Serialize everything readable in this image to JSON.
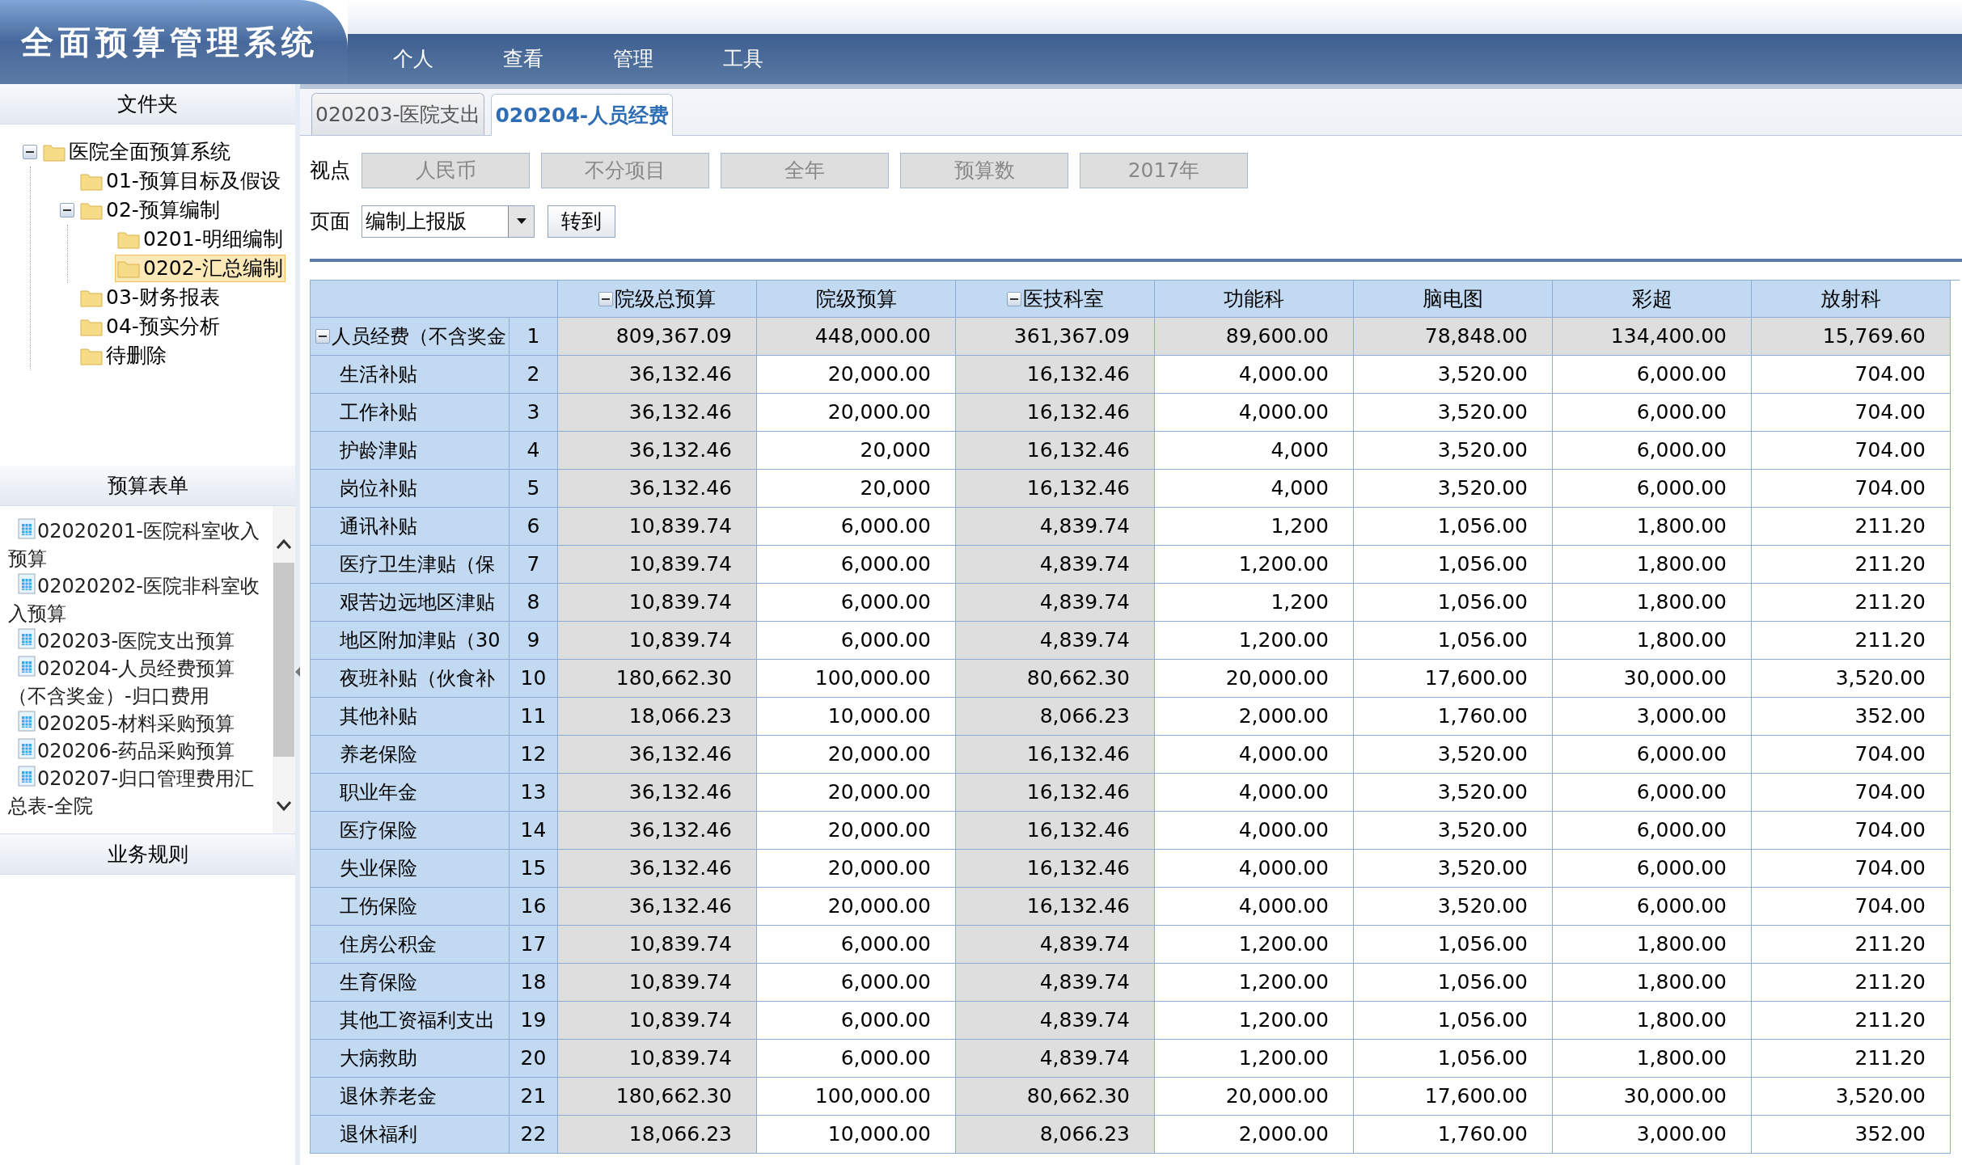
{
  "app": {
    "title": "全面预算管理系统",
    "menu": [
      "个人",
      "查看",
      "管理",
      "工具"
    ]
  },
  "sidebar": {
    "folders_panel": {
      "title": "文件夹",
      "tree": [
        {
          "label": "医院全面预算系统",
          "expanded": true,
          "selected": false,
          "children": [
            {
              "label": "01-预算目标及假设",
              "selected": false
            },
            {
              "label": "02-预算编制",
              "expanded": true,
              "selected": false,
              "children": [
                {
                  "label": "0201-明细编制",
                  "selected": false
                },
                {
                  "label": "0202-汇总编制",
                  "selected": true
                }
              ]
            },
            {
              "label": "03-财务报表",
              "selected": false
            },
            {
              "label": "04-预实分析",
              "selected": false
            },
            {
              "label": "待删除",
              "selected": false
            }
          ]
        }
      ]
    },
    "forms_panel": {
      "title": "预算表单",
      "items": [
        "02020201-医院科室收入预算",
        "02020202-医院非科室收入预算",
        "020203-医院支出预算",
        "020204-人员经费预算（不含奖金）-归口费用",
        "020205-材料采购预算",
        "020206-药品采购预算",
        "020207-归口管理费用汇总表-全院"
      ]
    },
    "rules_panel": {
      "title": "业务规则"
    }
  },
  "tabs": [
    {
      "label": "020203-医院支出",
      "selected": false
    },
    {
      "label": "020204-人员经费",
      "selected": true
    }
  ],
  "toolbar": {
    "viewpoint_label": "视点",
    "viewpoints": [
      "人民币",
      "不分项目",
      "全年",
      "预算数",
      "2017年"
    ],
    "page_label": "页面",
    "page_select": {
      "value": "编制上报版"
    },
    "go_button": "转到"
  },
  "table": {
    "columns": [
      {
        "label": "院级总预算",
        "kind": "group",
        "expanded": true
      },
      {
        "label": "院级预算",
        "kind": "leaf"
      },
      {
        "label": "医技科室",
        "kind": "group",
        "expanded": true
      },
      {
        "label": "功能科",
        "kind": "leaf"
      },
      {
        "label": "脑电图",
        "kind": "leaf"
      },
      {
        "label": "彩超",
        "kind": "leaf"
      },
      {
        "label": "放射科",
        "kind": "leaf"
      }
    ],
    "rows": [
      {
        "kind": "group",
        "expanded": true,
        "label": "人员经费（不含奖金",
        "num": "1",
        "values": [
          "809,367.09",
          "448,000.00",
          "361,367.09",
          "89,600.00",
          "78,848.00",
          "134,400.00",
          "15,769.60"
        ]
      },
      {
        "kind": "item",
        "label": "生活补贴",
        "num": "2",
        "values": [
          "36,132.46",
          "20,000.00",
          "16,132.46",
          "4,000.00",
          "3,520.00",
          "6,000.00",
          "704.00"
        ]
      },
      {
        "kind": "item",
        "label": "工作补贴",
        "num": "3",
        "values": [
          "36,132.46",
          "20,000.00",
          "16,132.46",
          "4,000.00",
          "3,520.00",
          "6,000.00",
          "704.00"
        ]
      },
      {
        "kind": "item",
        "label": "护龄津贴",
        "num": "4",
        "values": [
          "36,132.46",
          "20,000",
          "16,132.46",
          "4,000",
          "3,520.00",
          "6,000.00",
          "704.00"
        ]
      },
      {
        "kind": "item",
        "label": "岗位补贴",
        "num": "5",
        "values": [
          "36,132.46",
          "20,000",
          "16,132.46",
          "4,000",
          "3,520.00",
          "6,000.00",
          "704.00"
        ]
      },
      {
        "kind": "item",
        "label": "通讯补贴",
        "num": "6",
        "values": [
          "10,839.74",
          "6,000.00",
          "4,839.74",
          "1,200",
          "1,056.00",
          "1,800.00",
          "211.20"
        ]
      },
      {
        "kind": "item",
        "label": "医疗卫生津贴（保",
        "num": "7",
        "values": [
          "10,839.74",
          "6,000.00",
          "4,839.74",
          "1,200.00",
          "1,056.00",
          "1,800.00",
          "211.20"
        ]
      },
      {
        "kind": "item",
        "label": "艰苦边远地区津贴",
        "num": "8",
        "values": [
          "10,839.74",
          "6,000.00",
          "4,839.74",
          "1,200",
          "1,056.00",
          "1,800.00",
          "211.20"
        ]
      },
      {
        "kind": "item",
        "label": "地区附加津贴（30",
        "num": "9",
        "values": [
          "10,839.74",
          "6,000.00",
          "4,839.74",
          "1,200.00",
          "1,056.00",
          "1,800.00",
          "211.20"
        ]
      },
      {
        "kind": "item",
        "label": "夜班补贴（伙食补",
        "num": "10",
        "values": [
          "180,662.30",
          "100,000.00",
          "80,662.30",
          "20,000.00",
          "17,600.00",
          "30,000.00",
          "3,520.00"
        ]
      },
      {
        "kind": "item",
        "label": "其他补贴",
        "num": "11",
        "values": [
          "18,066.23",
          "10,000.00",
          "8,066.23",
          "2,000.00",
          "1,760.00",
          "3,000.00",
          "352.00"
        ]
      },
      {
        "kind": "item",
        "label": "养老保险",
        "num": "12",
        "values": [
          "36,132.46",
          "20,000.00",
          "16,132.46",
          "4,000.00",
          "3,520.00",
          "6,000.00",
          "704.00"
        ]
      },
      {
        "kind": "item",
        "label": "职业年金",
        "num": "13",
        "values": [
          "36,132.46",
          "20,000.00",
          "16,132.46",
          "4,000.00",
          "3,520.00",
          "6,000.00",
          "704.00"
        ]
      },
      {
        "kind": "item",
        "label": "医疗保险",
        "num": "14",
        "values": [
          "36,132.46",
          "20,000.00",
          "16,132.46",
          "4,000.00",
          "3,520.00",
          "6,000.00",
          "704.00"
        ]
      },
      {
        "kind": "item",
        "label": "失业保险",
        "num": "15",
        "values": [
          "36,132.46",
          "20,000.00",
          "16,132.46",
          "4,000.00",
          "3,520.00",
          "6,000.00",
          "704.00"
        ]
      },
      {
        "kind": "item",
        "label": "工伤保险",
        "num": "16",
        "values": [
          "36,132.46",
          "20,000.00",
          "16,132.46",
          "4,000.00",
          "3,520.00",
          "6,000.00",
          "704.00"
        ]
      },
      {
        "kind": "item",
        "label": "住房公积金",
        "num": "17",
        "values": [
          "10,839.74",
          "6,000.00",
          "4,839.74",
          "1,200.00",
          "1,056.00",
          "1,800.00",
          "211.20"
        ]
      },
      {
        "kind": "item",
        "label": "生育保险",
        "num": "18",
        "values": [
          "10,839.74",
          "6,000.00",
          "4,839.74",
          "1,200.00",
          "1,056.00",
          "1,800.00",
          "211.20"
        ]
      },
      {
        "kind": "item",
        "label": "其他工资福利支出",
        "num": "19",
        "values": [
          "10,839.74",
          "6,000.00",
          "4,839.74",
          "1,200.00",
          "1,056.00",
          "1,800.00",
          "211.20"
        ]
      },
      {
        "kind": "item",
        "label": "大病救助",
        "num": "20",
        "values": [
          "10,839.74",
          "6,000.00",
          "4,839.74",
          "1,200.00",
          "1,056.00",
          "1,800.00",
          "211.20"
        ]
      },
      {
        "kind": "item",
        "label": "退休养老金",
        "num": "21",
        "values": [
          "180,662.30",
          "100,000.00",
          "80,662.30",
          "20,000.00",
          "17,600.00",
          "30,000.00",
          "3,520.00"
        ]
      },
      {
        "kind": "item",
        "label": "退休福利",
        "num": "22",
        "values": [
          "18,066.23",
          "10,000.00",
          "8,066.23",
          "2,000.00",
          "1,760.00",
          "3,000.00",
          "352.00"
        ]
      }
    ]
  }
}
